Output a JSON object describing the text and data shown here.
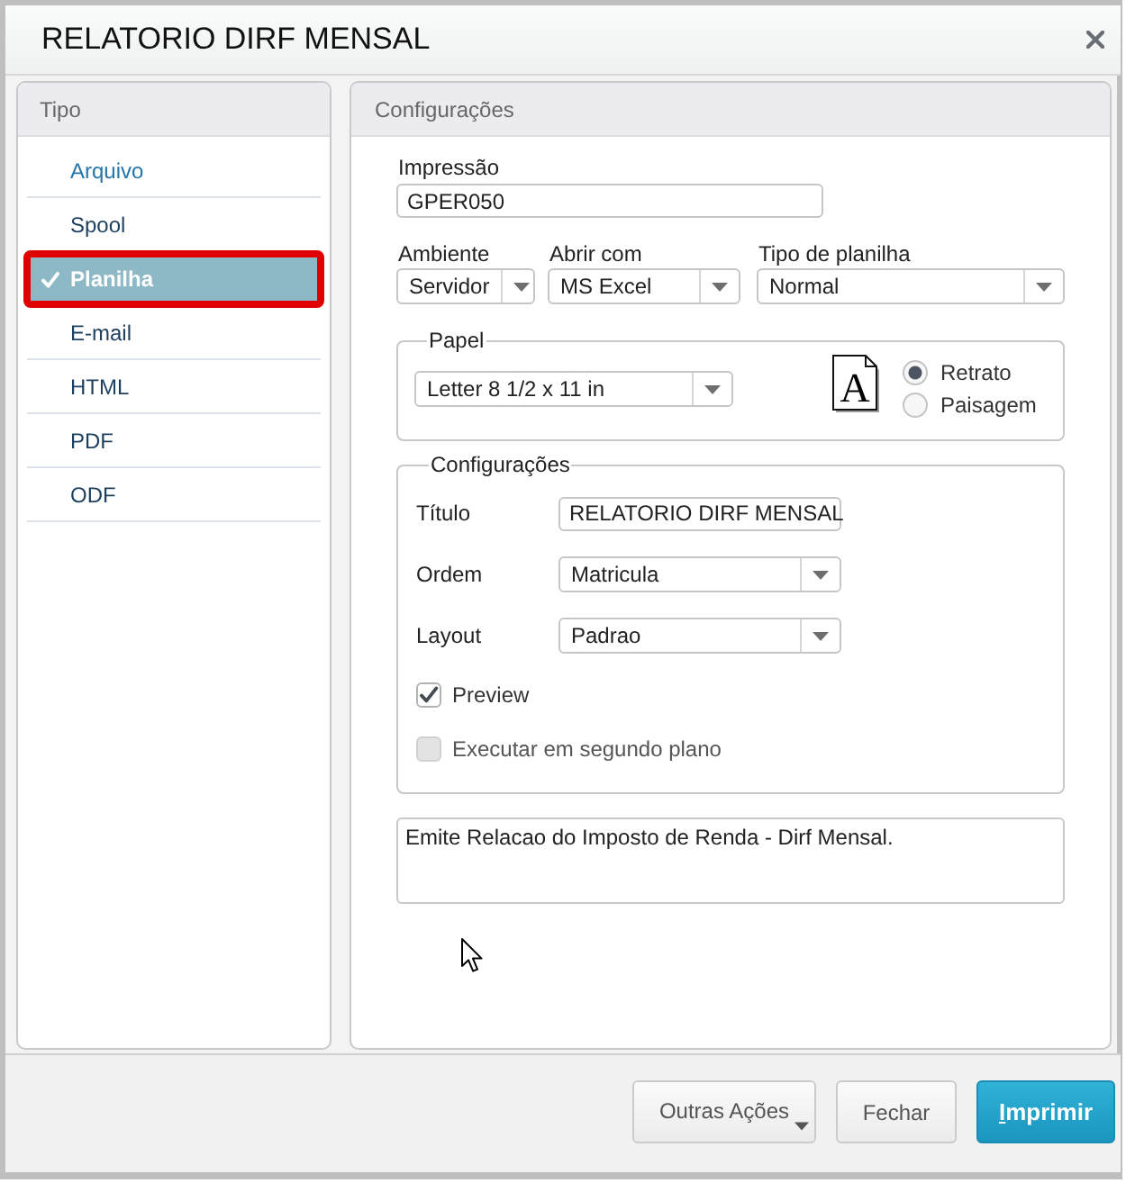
{
  "window": {
    "title": "RELATORIO DIRF MENSAL"
  },
  "sidebar": {
    "title": "Tipo",
    "items": [
      {
        "label": "Arquivo",
        "selected": false,
        "hovered": true,
        "highlighted": false
      },
      {
        "label": "Spool",
        "selected": false,
        "hovered": false,
        "highlighted": false
      },
      {
        "label": "Planilha",
        "selected": true,
        "hovered": false,
        "highlighted": true
      },
      {
        "label": "E-mail",
        "selected": false,
        "hovered": false,
        "highlighted": false
      },
      {
        "label": "HTML",
        "selected": false,
        "hovered": false,
        "highlighted": false
      },
      {
        "label": "PDF",
        "selected": false,
        "hovered": false,
        "highlighted": false
      },
      {
        "label": "ODF",
        "selected": false,
        "hovered": false,
        "highlighted": false
      }
    ]
  },
  "config": {
    "title": "Configurações",
    "print": {
      "label": "Impressão",
      "value": "GPER050"
    },
    "selects": [
      {
        "label": "Ambiente",
        "value": "Servidor"
      },
      {
        "label": "Abrir com",
        "value": "MS Excel"
      },
      {
        "label": "Tipo de planilha",
        "value": "Normal"
      }
    ],
    "paper": {
      "legend": "Papel",
      "size": "Letter 8 1/2 x 11 in",
      "page_icon_letter": "A",
      "orientations": [
        {
          "label": "Retrato",
          "selected": true
        },
        {
          "label": "Paisagem",
          "selected": false
        }
      ]
    },
    "settings": {
      "legend": "Configurações",
      "fields": [
        {
          "kind": "text",
          "label": "Título",
          "value": "RELATORIO DIRF MENSAL"
        },
        {
          "kind": "select",
          "label": "Ordem",
          "value": "Matricula"
        },
        {
          "kind": "select",
          "label": "Layout",
          "value": "Padrao"
        }
      ],
      "options": [
        {
          "label": "Preview",
          "checked": true,
          "disabled": false
        },
        {
          "label": "Executar em segundo plano",
          "checked": false,
          "disabled": true
        }
      ]
    },
    "description": "Emite Relacao do Imposto de Renda - Dirf Mensal."
  },
  "footer": {
    "buttons": [
      {
        "label": "Outras Ações",
        "kind": "menu",
        "mnemonic_underlined": false
      },
      {
        "label": "Fechar",
        "kind": "plain",
        "mnemonic_underlined": false
      },
      {
        "label": "Imprimir",
        "kind": "primary",
        "mnemonic_underlined": true
      }
    ]
  }
}
